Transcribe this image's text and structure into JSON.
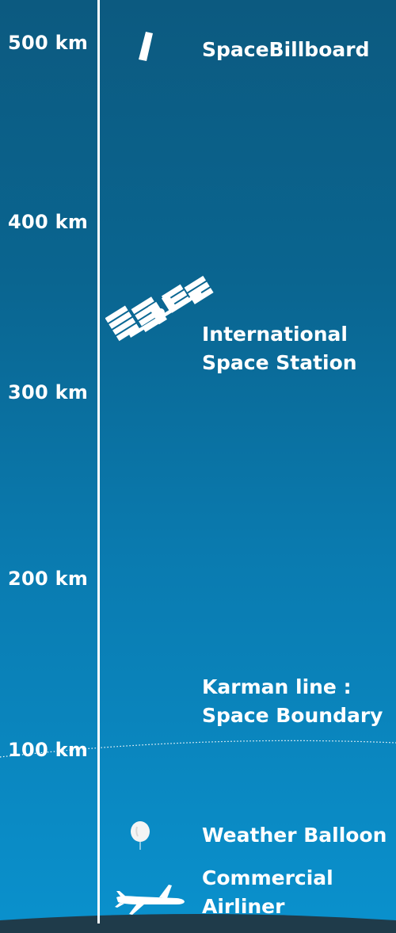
{
  "scale": {
    "km_500": "500 km",
    "km_400": "400 km",
    "km_300": "300 km",
    "km_200": "200 km",
    "km_100": "100 km"
  },
  "items": {
    "billboard": {
      "label": "SpaceBillboard",
      "icon": "billboard-satellite-icon"
    },
    "iss": {
      "line1": "International",
      "line2": "Space Station",
      "icon": "space-station-icon"
    },
    "karman": {
      "line1": "Karman line :",
      "line2": "Space Boundary"
    },
    "balloon": {
      "label": "Weather Balloon",
      "icon": "weather-balloon-icon"
    },
    "airliner": {
      "line1": "Commercial",
      "line2": "Airliner",
      "icon": "airplane-icon"
    }
  },
  "colors": {
    "sky_top": "#0c5a80",
    "sky_bottom": "#0a91cd",
    "text": "#ffffff",
    "ground": "#1f3b4a"
  }
}
